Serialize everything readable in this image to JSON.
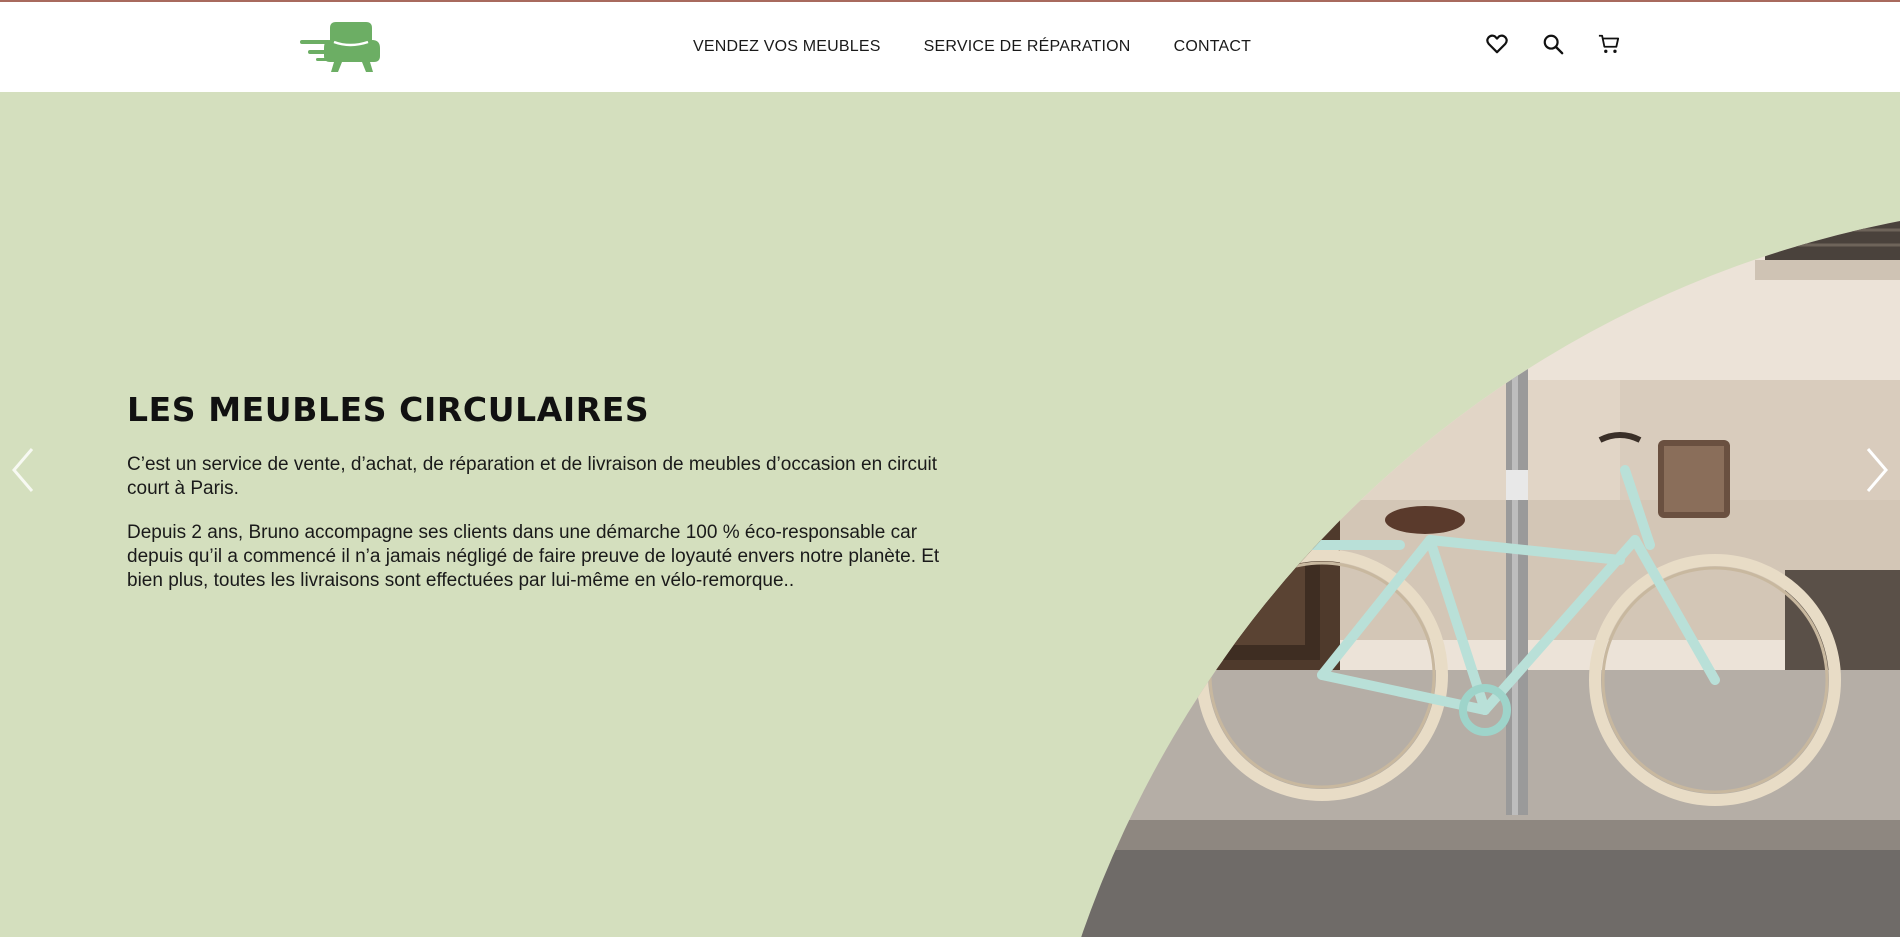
{
  "brand": {
    "logo_icon": "armchair-speed-icon",
    "accent_color": "#6cae64"
  },
  "nav": {
    "items": [
      {
        "label": "VENDEZ VOS MEUBLES"
      },
      {
        "label": "SERVICE DE RÉPARATION"
      },
      {
        "label": "CONTACT"
      }
    ]
  },
  "header_icons": [
    "heart-icon",
    "search-icon",
    "cart-icon"
  ],
  "hero": {
    "title": "LES MEUBLES CIRCULAIRES",
    "paragraphs": [
      "C’est un service de vente, d’achat, de réparation et de livraison de meubles d’occasion en circuit court à Paris.",
      "Depuis 2 ans, Bruno accompagne ses clients dans une démarche 100 % éco-responsable car depuis qu’il a commencé il n’a jamais négligé de faire preuve de loyauté envers notre planète. Et bien plus, toutes les livraisons sont effectuées par lui-même en vélo-remorque.."
    ],
    "background_color": "#d4dfbe",
    "image_subject": "mint-green bicycle leaning on a pole in front of a building"
  },
  "carousel": {
    "prev_icon": "chevron-left-icon",
    "next_icon": "chevron-right-icon"
  }
}
